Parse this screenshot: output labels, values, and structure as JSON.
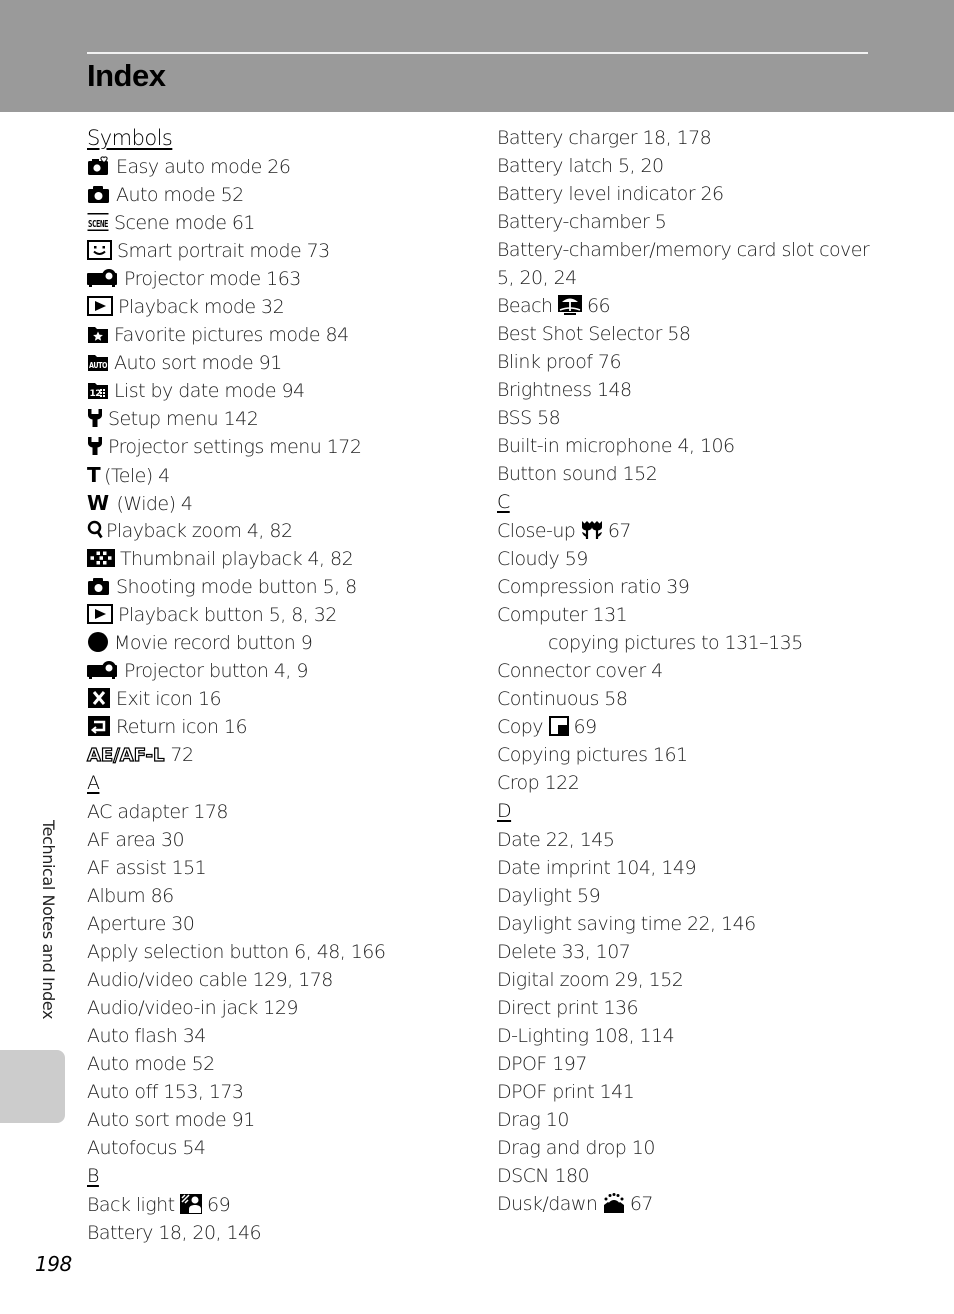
{
  "header": {
    "title": "Index"
  },
  "side_tab": {
    "label": "Technical Notes and Index"
  },
  "page_number": "198",
  "left_column": {
    "symbols_heading": "Symbols",
    "symbols": [
      {
        "icon": "easy-auto-icon",
        "text": "Easy auto mode 26"
      },
      {
        "icon": "camera-icon",
        "text": "Auto mode 52"
      },
      {
        "icon": "scene-icon",
        "text": "Scene mode 61"
      },
      {
        "icon": "smart-portrait-icon",
        "text": "Smart portrait mode 73"
      },
      {
        "icon": "projector-icon",
        "text": "Projector mode 163"
      },
      {
        "icon": "playback-icon",
        "text": "Playback mode 32"
      },
      {
        "icon": "favorite-icon",
        "text": "Favorite pictures mode 84"
      },
      {
        "icon": "auto-sort-icon",
        "text": "Auto sort mode 91"
      },
      {
        "icon": "list-by-date-icon",
        "text": "List by date mode 94"
      },
      {
        "icon": "wrench-icon",
        "text": "Setup menu 142"
      },
      {
        "icon": "wrench-icon",
        "text": "Projector settings menu 172"
      },
      {
        "icon": "tele-icon",
        "text": "(Tele) 4",
        "glyph": "T"
      },
      {
        "icon": "wide-icon",
        "text": "(Wide) 4",
        "glyph": "W"
      },
      {
        "icon": "magnifier-icon",
        "text": "Playback zoom 4, 82"
      },
      {
        "icon": "thumbnail-icon",
        "text": "Thumbnail playback 4, 82"
      },
      {
        "icon": "camera-icon",
        "text": "Shooting mode button 5, 8"
      },
      {
        "icon": "playback-icon",
        "text": "Playback button 5, 8, 32"
      },
      {
        "icon": "record-icon",
        "text": "Movie record button 9"
      },
      {
        "icon": "projector-icon",
        "text": "Projector button 4, 9"
      },
      {
        "icon": "exit-icon",
        "text": "Exit icon 16"
      },
      {
        "icon": "return-icon",
        "text": "Return icon 16"
      },
      {
        "icon": "ae-af-lock-icon",
        "text": "72",
        "glyph": "AE/AF-L"
      }
    ],
    "a_heading": "A",
    "a_entries": [
      "AC adapter 178",
      "AF area 30",
      "AF assist 151",
      "Album 86",
      "Aperture 30",
      "Apply selection button 6, 48, 166",
      "Audio/video cable 129, 178",
      "Audio/video-in jack 129",
      "Auto flash 34",
      "Auto mode 52",
      "Auto off 153, 173",
      "Auto sort mode 91",
      "Autofocus 54"
    ],
    "b_heading": "B",
    "b_entries": [
      {
        "pre": "Back light",
        "icon": "backlight-icon",
        "post": "69"
      },
      {
        "text": "Battery 18, 20, 146"
      }
    ]
  },
  "right_column": {
    "b_entries": [
      "Battery charger 18, 178",
      "Battery latch 5, 20",
      "Battery level indicator 26",
      "Battery-chamber 5",
      "Battery-chamber/memory card slot cover",
      "5, 20, 24"
    ],
    "beach": {
      "pre": "Beach",
      "icon": "beach-icon",
      "post": "66"
    },
    "b_entries2": [
      "Best Shot Selector 58",
      "Blink proof 76",
      "Brightness 148",
      "BSS 58",
      "Built-in microphone 4, 106",
      "Button sound 152"
    ],
    "c_heading": "C",
    "closeup": {
      "pre": "Close-up",
      "icon": "close-up-icon",
      "post": "67"
    },
    "c_entries": [
      "Cloudy 59",
      "Compression ratio 39",
      "Computer 131"
    ],
    "c_sub": "copying pictures to 131–135",
    "c_entries2": [
      "Connector cover 4",
      "Continuous 58"
    ],
    "copy": {
      "pre": "Copy",
      "icon": "copy-icon",
      "post": "69"
    },
    "c_entries3": [
      "Copying pictures 161",
      "Crop 122"
    ],
    "d_heading": "D",
    "d_entries": [
      "Date 22, 145",
      "Date imprint 104, 149",
      "Daylight 59",
      "Daylight saving time 22, 146",
      "Delete 33, 107",
      "Digital zoom 29, 152",
      "Direct print 136",
      "D-Lighting 108, 114",
      "DPOF 197",
      "DPOF print 141",
      "Drag 10",
      "Drag and drop 10",
      "DSCN 180"
    ],
    "dusk": {
      "pre": "Dusk/dawn",
      "icon": "dusk-dawn-icon",
      "post": "67"
    }
  },
  "colors": {
    "header_bg": "#9a9a9a",
    "side_tab_bg": "#cccccc",
    "text": "#222222"
  }
}
